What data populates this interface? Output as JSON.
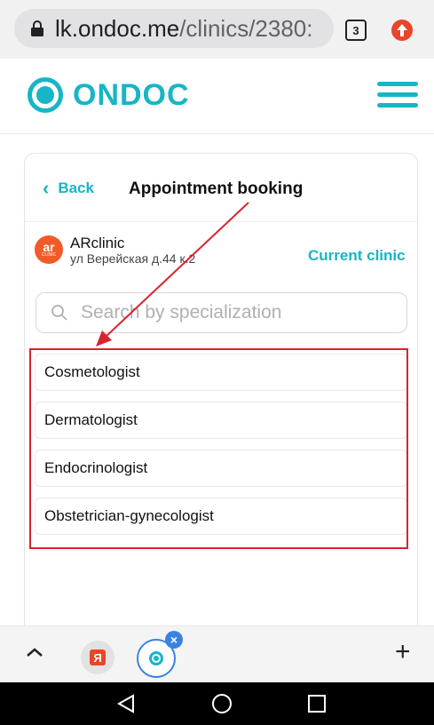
{
  "browser": {
    "url_host": "lk.ondoc.me",
    "url_path": "/clinics/2380:",
    "tab_count": "3"
  },
  "site": {
    "logo_text": "ONDOC",
    "brand_color": "#17b5c6"
  },
  "booking": {
    "back_label": "Back",
    "title": "Appointment booking",
    "clinic": {
      "avatar_text": "ar",
      "avatar_sub": "CLINIC",
      "name": "ARclinic",
      "address": "ул Верейская д.44 к.2",
      "current_label": "Current clinic"
    },
    "search": {
      "placeholder": "Search by specialization",
      "value": ""
    },
    "specializations": [
      "Cosmetologist",
      "Dermatologist",
      "Endocrinologist",
      "Obstetrician-gynecologist"
    ]
  },
  "bottom_toolbar": {
    "yandex_label": "Я",
    "close_label": "×",
    "new_tab_label": "+"
  },
  "annotation_color": "#d9232e"
}
